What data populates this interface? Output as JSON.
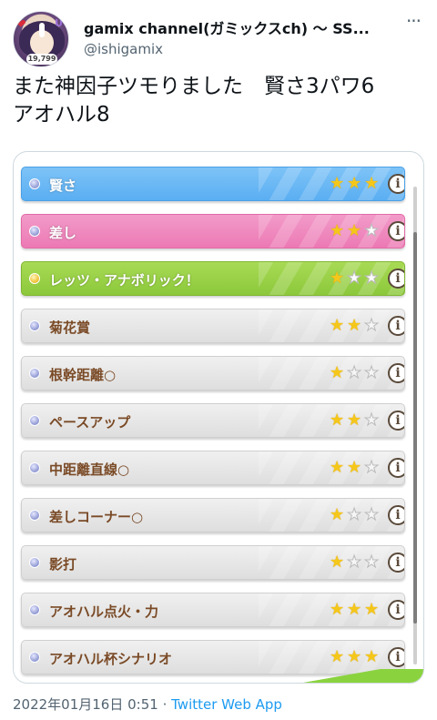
{
  "user": {
    "display_name": "gamix channel(ガミックスch) 〜 SS...",
    "handle": "@ishigamix",
    "avatar_badge": "19,799"
  },
  "tweet": {
    "text": "また神因子ツモりました　賢さ3パワ6\nアオハル8"
  },
  "media": {
    "skills": [
      {
        "name": "賢さ",
        "stars": 3,
        "type": "gold"
      },
      {
        "name": "差し",
        "stars": 2,
        "type": "pink"
      },
      {
        "name": "レッツ・アナボリック！",
        "stars": 1,
        "type": "green"
      },
      {
        "name": "菊花賞",
        "stars": 2,
        "type": "white"
      },
      {
        "name": "根幹距離○",
        "stars": 1,
        "type": "white"
      },
      {
        "name": "ペースアップ",
        "stars": 2,
        "type": "white"
      },
      {
        "name": "中距離直線○",
        "stars": 2,
        "type": "white"
      },
      {
        "name": "差しコーナー○",
        "stars": 1,
        "type": "white"
      },
      {
        "name": "影打",
        "stars": 1,
        "type": "white"
      },
      {
        "name": "アオハル点火・力",
        "stars": 3,
        "type": "white"
      },
      {
        "name": "アオハル杯シナリオ",
        "stars": 3,
        "type": "white"
      }
    ],
    "colors": {
      "gold": "#5aaef2",
      "pink": "#ec79b4",
      "green": "#8cc83b",
      "white": "#e4e4e4",
      "star": "#f5c71a"
    }
  },
  "footer": {
    "datetime": "2022年01月16日 0:51",
    "separator": " · ",
    "source": "Twitter Web App"
  }
}
